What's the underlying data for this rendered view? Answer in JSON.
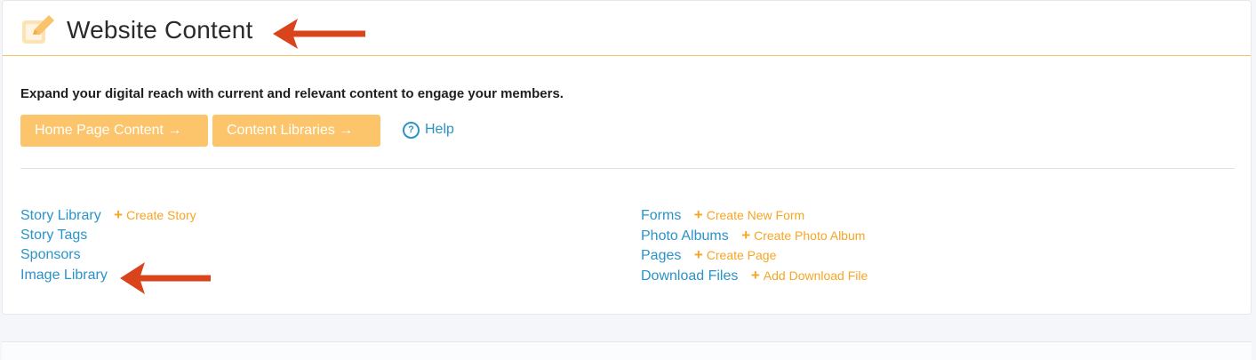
{
  "header": {
    "title": "Website Content",
    "icon": "edit-icon"
  },
  "intro_text": "Expand your digital reach with current and relevant content to engage your members.",
  "buttons": {
    "home_page_content": "Home Page Content →",
    "content_libraries": "Content Libraries →"
  },
  "help": {
    "label": "Help",
    "icon": "?"
  },
  "left_links": [
    {
      "label": "Story Library",
      "create": "Create Story"
    },
    {
      "label": "Story Tags"
    },
    {
      "label": "Sponsors"
    },
    {
      "label": "Image Library"
    }
  ],
  "right_links": [
    {
      "label": "Forms",
      "create": "Create New Form"
    },
    {
      "label": "Photo Albums",
      "create": "Create Photo Album"
    },
    {
      "label": "Pages",
      "create": "Create Page"
    },
    {
      "label": "Download Files",
      "create": "Add Download File"
    }
  ],
  "colors": {
    "accent": "#fcc46b",
    "link": "#2a93c8",
    "create_link": "#f6a623",
    "annotation_arrow": "#d9441c"
  }
}
